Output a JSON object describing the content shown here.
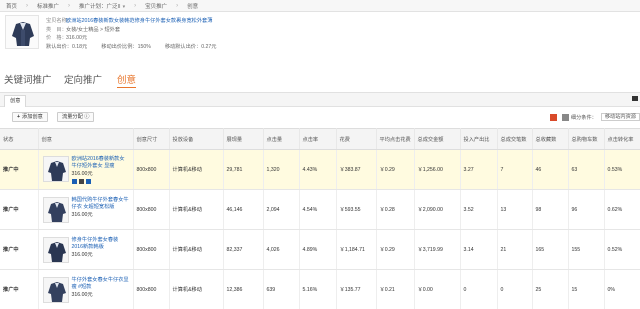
{
  "breadcrumb": [
    "首页",
    "标准推广",
    "推广计划：广泛II",
    "宝贝推广",
    "创意"
  ],
  "product": {
    "title_label": "宝贝名称：",
    "title": "欧洲站2016春装新款女装韩范修身牛仔外套女款裹身宽松外套薄",
    "category_label": "类　目：",
    "category": "女装/女士精品 > 短外套",
    "price_label": "价　格：",
    "price": "316.00元",
    "default_bid_label": "默认出价：",
    "default_bid": "0.18元",
    "mobile_ratio_label": "移动出价比例：",
    "mobile_ratio": "150%",
    "mobile_bid_label": "移动默认出价：",
    "mobile_bid": "0.27元"
  },
  "tabs": [
    {
      "label": "关键词推广",
      "active": false
    },
    {
      "label": "定向推广",
      "active": false
    },
    {
      "label": "创意",
      "active": true
    }
  ],
  "subtab": "创意",
  "toolbar": {
    "add_label": "添加创意",
    "flow_label": "流量分配",
    "report_label": "细分条件：",
    "select_label": "移动站内资源"
  },
  "table": {
    "headers": [
      "状态",
      "创意",
      "创意尺寸",
      "投放设备",
      "展现量",
      "点击量",
      "点击率",
      "花费",
      "平均点击花费",
      "总成交金额",
      "投入产出比",
      "总成交笔数",
      "总收藏数",
      "总购物车数",
      "点击转化率"
    ],
    "rows": [
      {
        "status": "推广中",
        "title": "欧洲站2016春装新款女牛仔短外套女 显瘦",
        "price": "316.00元",
        "size": "800x800",
        "device": "计算机&移动",
        "impressions": "29,781",
        "clicks": "1,320",
        "ctr": "4.43%",
        "cost": "￥383.87",
        "cpc": "￥0.29",
        "gmv": "￥1,256.00",
        "roi": "3.27",
        "orders": "7",
        "favorites": "46",
        "carts": "63",
        "cvr": "0.53%",
        "selected": true
      },
      {
        "status": "推广中",
        "title": "韩国代购牛仔外套春女牛仔衣 女超短宽松版",
        "price": "316.00元",
        "size": "800x800",
        "device": "计算机&移动",
        "impressions": "46,146",
        "clicks": "2,094",
        "ctr": "4.54%",
        "cost": "￥593.55",
        "cpc": "￥0.28",
        "gmv": "￥2,090.00",
        "roi": "3.52",
        "orders": "13",
        "favorites": "98",
        "carts": "96",
        "cvr": "0.62%",
        "selected": false
      },
      {
        "status": "推广中",
        "title": "修身牛仔外套女春装2016新款韩版",
        "price": "316.00元",
        "size": "800x800",
        "device": "计算机&移动",
        "impressions": "82,337",
        "clicks": "4,026",
        "ctr": "4.89%",
        "cost": "￥1,184.71",
        "cpc": "￥0.29",
        "gmv": "￥3,719.99",
        "roi": "3.14",
        "orders": "21",
        "favorites": "165",
        "carts": "155",
        "cvr": "0.52%",
        "selected": false
      },
      {
        "status": "推广中",
        "title": "牛仔外套女春女牛仔衣显瘦 #短款",
        "price": "316.00元",
        "size": "800x800",
        "device": "计算机&移动",
        "impressions": "12,386",
        "clicks": "639",
        "ctr": "5.16%",
        "cost": "￥135.77",
        "cpc": "￥0.21",
        "gmv": "￥0.00",
        "roi": "0",
        "orders": "0",
        "favorites": "25",
        "carts": "15",
        "cvr": "0%",
        "selected": false
      }
    ]
  }
}
